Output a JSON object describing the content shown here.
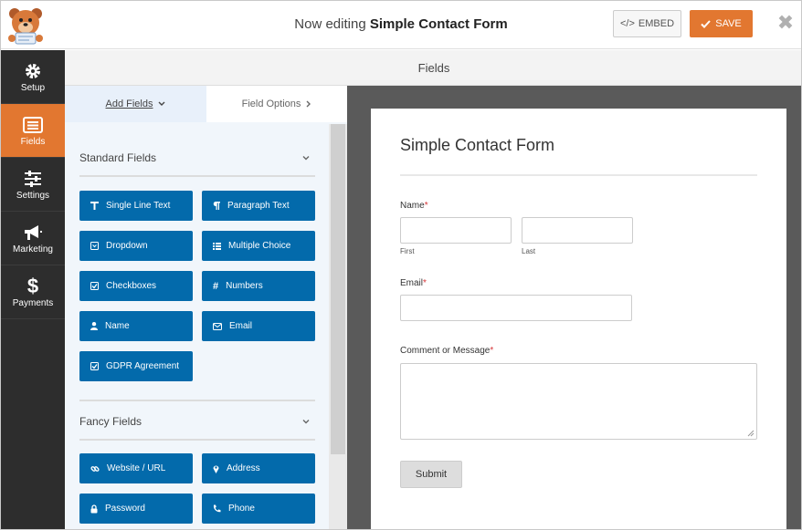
{
  "header": {
    "title_prefix": "Now editing",
    "title_form": "Simple Contact Form",
    "embed_label": "EMBED",
    "save_label": "SAVE",
    "close_glyph": "✖"
  },
  "sidebar": {
    "items": [
      {
        "label": "Setup",
        "icon": "gear-icon"
      },
      {
        "label": "Fields",
        "icon": "fields-list-icon",
        "active": true
      },
      {
        "label": "Settings",
        "icon": "sliders-icon"
      },
      {
        "label": "Marketing",
        "icon": "megaphone-icon"
      },
      {
        "label": "Payments",
        "icon": "dollar-icon"
      }
    ]
  },
  "fields_bar": {
    "title": "Fields"
  },
  "panel": {
    "tabs": [
      {
        "label": "Add Fields",
        "icon": "chevron-down-icon"
      },
      {
        "label": "Field Options",
        "icon": "chevron-right-icon"
      }
    ],
    "standard": {
      "title": "Standard Fields",
      "buttons": [
        {
          "label": "Single Line Text",
          "icon": "text-icon"
        },
        {
          "label": "Paragraph Text",
          "icon": "paragraph-icon"
        },
        {
          "label": "Dropdown",
          "icon": "dropdown-icon"
        },
        {
          "label": "Multiple Choice",
          "icon": "list-icon"
        },
        {
          "label": "Checkboxes",
          "icon": "checkbox-icon"
        },
        {
          "label": "Numbers",
          "icon": "hash-icon"
        },
        {
          "label": "Name",
          "icon": "user-icon"
        },
        {
          "label": "Email",
          "icon": "envelope-icon"
        },
        {
          "label": "GDPR Agreement",
          "icon": "checkbox-icon"
        }
      ]
    },
    "fancy": {
      "title": "Fancy Fields",
      "buttons": [
        {
          "label": "Website / URL",
          "icon": "link-icon"
        },
        {
          "label": "Address",
          "icon": "map-marker-icon"
        },
        {
          "label": "Password",
          "icon": "lock-icon"
        },
        {
          "label": "Phone",
          "icon": "phone-icon"
        }
      ]
    }
  },
  "preview": {
    "form_title": "Simple Contact Form",
    "name_label": "Name",
    "required_mark": "*",
    "first_label": "First",
    "last_label": "Last",
    "email_label": "Email",
    "comment_label": "Comment or Message",
    "submit_label": "Submit"
  },
  "colors": {
    "accent": "#e27730",
    "field_button": "#036aab",
    "sidebar": "#2d2d2d"
  }
}
